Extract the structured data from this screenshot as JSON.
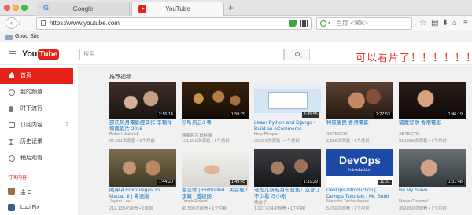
{
  "browser": {
    "tabs": [
      {
        "label": "Google"
      },
      {
        "label": "YouTube"
      }
    ],
    "new_tab": "+",
    "nav": {
      "back": "‹",
      "forward": "›"
    },
    "url": "https://www.youtube.com",
    "search_placeholder": "百度 <⌘K>",
    "toolbar_icons": [
      "star-icon",
      "reader-icon",
      "download-icon",
      "home-icon",
      "menu-icon"
    ],
    "bookmarks": {
      "label": "Good Site"
    }
  },
  "youtube": {
    "logo_you": "You",
    "logo_tube": "Tube",
    "search_placeholder": "搜索",
    "annotation": "可以看片了！！！！！！",
    "sidebar": {
      "items": [
        {
          "label": "首页",
          "icon": "home-icon"
        },
        {
          "label": "我的频道",
          "icon": "channel-icon"
        },
        {
          "label": "时下流行",
          "icon": "trending-icon"
        },
        {
          "label": "订阅内容",
          "icon": "subscriptions-icon",
          "count": "2"
        },
        {
          "label": "历史记录",
          "icon": "history-icon"
        },
        {
          "label": "稍后观看",
          "icon": "watch-later-icon"
        }
      ],
      "section": "订阅内容",
      "channels": [
        {
          "label": "金 C"
        },
        {
          "label": "Luzi Fix"
        }
      ]
    },
    "section_title": "推荐视频",
    "videos": [
      {
        "title": "邵氏风月電影經典作 李翰祥 懷舊影片 2016",
        "channel": "Robert Satchell",
        "meta": "67,921次观看 • 5个月前",
        "duration": "2:16:14"
      },
      {
        "title": "窃听风云3 粵",
        "channel": "國產影片資料庫",
        "meta": "151,818次观看 • 1个月前",
        "duration": "1:59:29"
      },
      {
        "title": "Learn Python and Django - Build an eCommerce Websit...",
        "channel": "Help People",
        "meta": "30,321次观看 • 4个月前",
        "duration": "3:35:55"
      },
      {
        "title": "特區愛民 香港電影",
        "channel": "SETECYM",
        "meta": "2,868次观看 • 1个月前",
        "duration": "1:27:53"
      },
      {
        "title": "驅魔警察 香港電影",
        "channel": "SETECYM",
        "meta": "315,686次观看 • 1个月前",
        "duration": "1:46:19"
      },
      {
        "title": "賭神 4 From Vegas To Macau Ⅲ | 粵语版",
        "channel": "Jayton Lee",
        "meta": "212,139次观看 • 1周前",
        "duration": "1:44:20"
      },
      {
        "title": "愛恋歌 ( Enthralled ) 关谷毅 / 李蔵 / 盛颖朗",
        "channel": "Tanya Robert",
        "meta": "80,509次观看 • 1个月前",
        "duration": "1:49:45"
      },
      {
        "title": "老炮儿新城月份合集）这部了不少看 冯小刚",
        "channel": "熊孩子",
        "meta": "1,027,614次观看 • 1个月前",
        "duration": "1:31:29"
      },
      {
        "title": "DevOps Introduction | Devops Tutorials | Mr. Sunil",
        "channel": "Naresh i Technologies",
        "meta": "5,702次观看 • 2个月前",
        "duration": "11:31",
        "art_title": "DevOps",
        "art_sub": "Introduction"
      },
      {
        "title": "Be My Slave",
        "channel": "Movie Channel",
        "meta": "369,859次观看 • 1个月前",
        "duration": "1:31:48"
      }
    ]
  }
}
